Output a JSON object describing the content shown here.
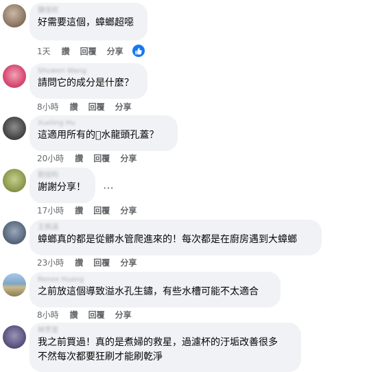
{
  "actions": {
    "like": "讚",
    "reply": "回覆",
    "share": "分享"
  },
  "more_icon": "⋯",
  "comments": [
    {
      "name": "鍾佳欣",
      "text": [
        "好需要這個，蟑螂超噁"
      ],
      "time": "1天",
      "reaction": "like-icon"
    },
    {
      "name": "Shuwen Wang",
      "text": [
        "請問它的成分是什麼？"
      ],
      "time": "8小時"
    },
    {
      "name": "Xueling Hu",
      "text": [
        "這適用所有的\u0000水龍頭孔蓋？"
      ],
      "time": "20小時"
    },
    {
      "name": "劉佳昀",
      "text": [
        "謝謝分享！"
      ],
      "time": "17小時"
    },
    {
      "name": "王佩涵",
      "text": [
        "蟑螂真的都是從髒水管爬進來的！每次都是在廚房遇到大蟑螂"
      ],
      "time": "23小時"
    },
    {
      "name": "Renee Huang",
      "text": [
        "之前放這個導致溢水孔生鏽，有些水槽可能不太適合"
      ],
      "time": "8小時"
    },
    {
      "name": "林芳宜",
      "text": [
        "我之前買過！真的是煮婦的救星，過濾杯的汙垢改善很多",
        "不然每次都要狂刷才能刷乾淨"
      ]
    }
  ]
}
